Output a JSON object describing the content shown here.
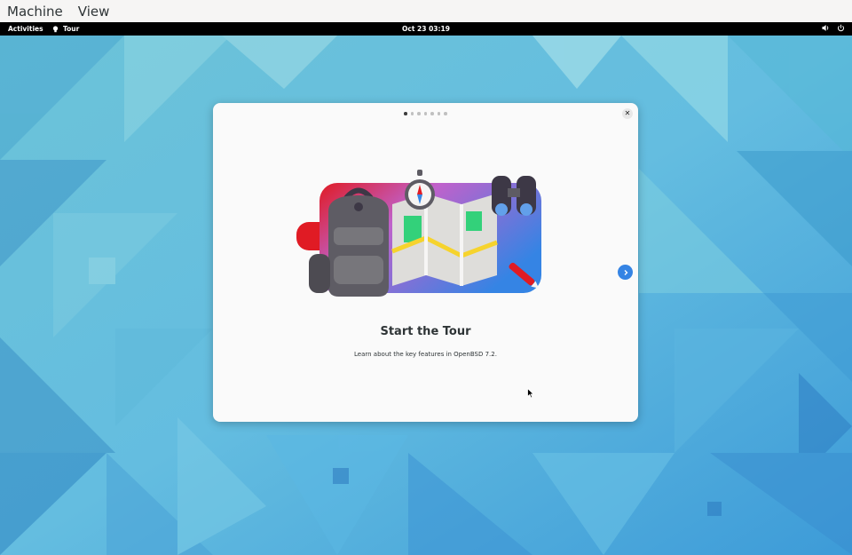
{
  "vm_menu": {
    "items": [
      {
        "label": "Machine"
      },
      {
        "label": "View"
      }
    ]
  },
  "topbar": {
    "activities": "Activities",
    "app_name": "Tour",
    "clock": "Oct 23  03:19",
    "icons": [
      "volume-icon",
      "power-icon"
    ]
  },
  "dialog": {
    "page_count": 7,
    "current_page": 1,
    "close_icon": "close-icon",
    "next_icon": "chevron-right-icon",
    "title": "Start the Tour",
    "subtitle": "Learn about the key features in OpenBSD 7.2.",
    "accent": "#3584e4"
  },
  "colors": {
    "wallpaper_base": "#5ab6d8",
    "topbar": "#000000"
  }
}
